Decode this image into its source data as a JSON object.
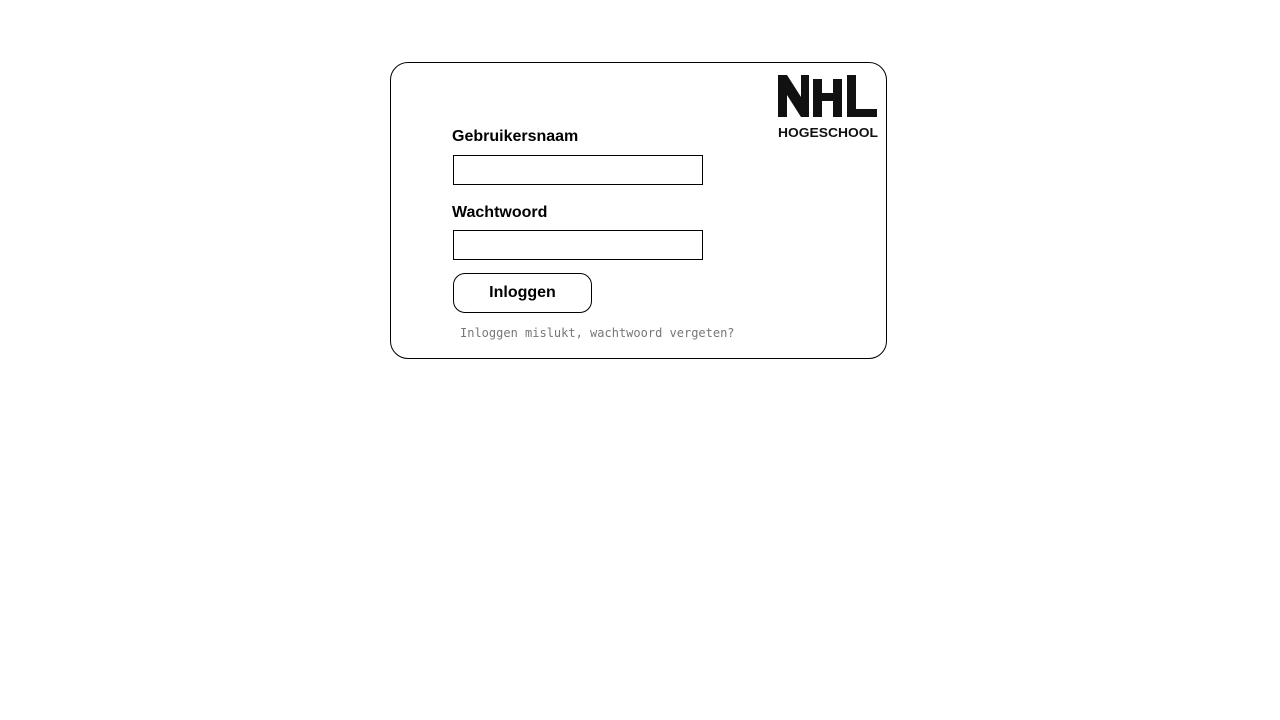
{
  "logo": {
    "wordmark": "NHL",
    "subtitle": "HOGESCHOOL"
  },
  "form": {
    "username_label": "Gebruikersnaam",
    "username_value": "",
    "password_label": "Wachtwoord",
    "password_value": "",
    "login_button_label": "Inloggen",
    "forgot_link_text": "Inloggen mislukt, wachtwoord vergeten?"
  },
  "colors": {
    "border": "#000000",
    "link": "#777777",
    "background": "#ffffff"
  }
}
